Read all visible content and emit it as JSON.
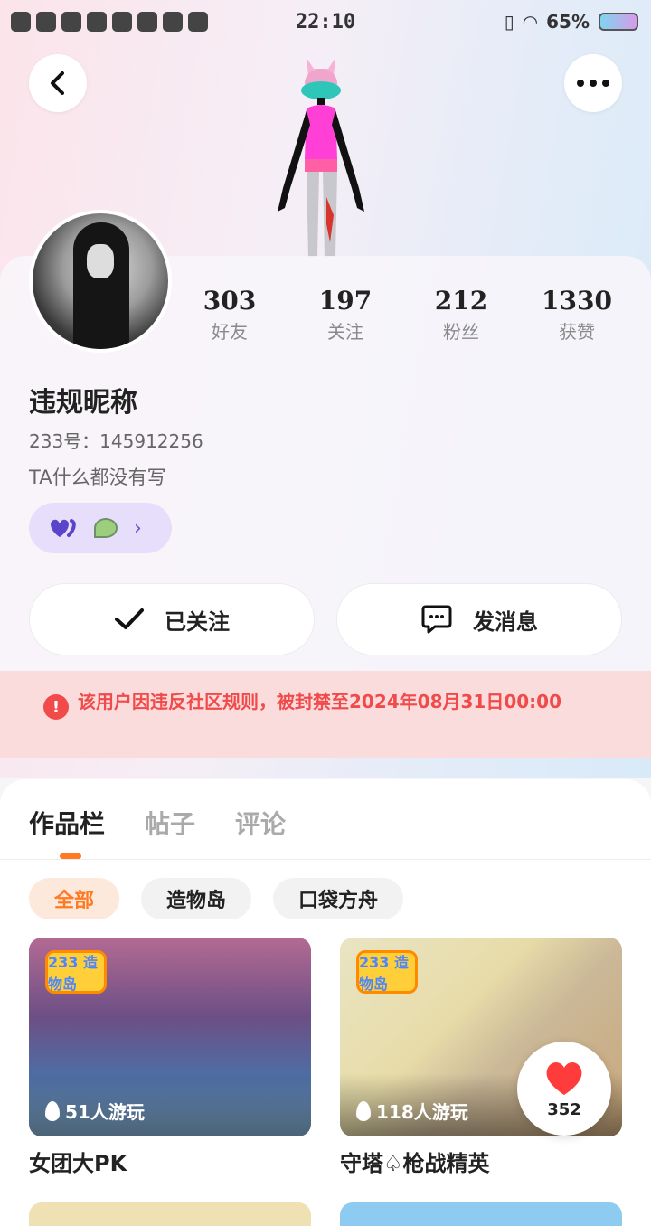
{
  "status_bar": {
    "time": "22:10",
    "battery": "65%"
  },
  "profile": {
    "nickname": "违规昵称",
    "uid": "233号：145912256",
    "bio": "TA什么都没有写"
  },
  "stats": [
    {
      "value": "303",
      "label": "好友"
    },
    {
      "value": "197",
      "label": "关注"
    },
    {
      "value": "212",
      "label": "粉丝"
    },
    {
      "value": "1330",
      "label": "获赞"
    }
  ],
  "actions": {
    "followed_label": "已关注",
    "message_label": "发消息"
  },
  "ban_notice": "该用户因违反社区规则，被封禁至2024年08月31日00:00",
  "tabs": [
    {
      "label": "作品栏",
      "active": true
    },
    {
      "label": "帖子",
      "active": false
    },
    {
      "label": "评论",
      "active": false
    }
  ],
  "filters": [
    {
      "label": "全部",
      "active": true
    },
    {
      "label": "造物岛",
      "active": false
    },
    {
      "label": "口袋方舟",
      "active": false
    }
  ],
  "works": [
    {
      "title": "女团大PK",
      "plays": "51人游玩",
      "logo": "233 造物岛"
    },
    {
      "title": "守塔♤枪战精英",
      "plays": "118人游玩",
      "logo": "233 造物岛"
    }
  ],
  "like_fab": {
    "count": "352"
  },
  "colors": {
    "accent": "#ff7a22",
    "ban_red": "#f04a4a",
    "badge_purple": "#e6defa"
  }
}
